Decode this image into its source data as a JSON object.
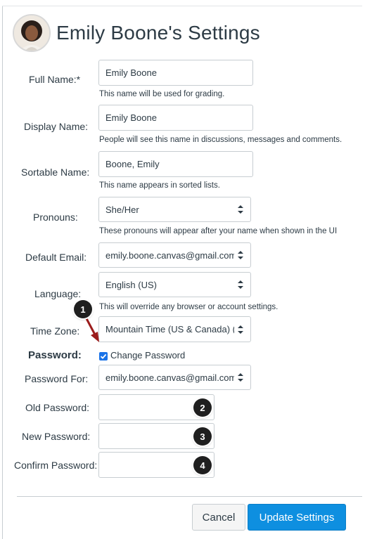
{
  "header": {
    "title": "Emily Boone's Settings"
  },
  "fields": {
    "full_name": {
      "label": "Full Name:*",
      "value": "Emily Boone",
      "hint": "This name will be used for grading."
    },
    "display_name": {
      "label": "Display Name:",
      "value": "Emily Boone",
      "hint": "People will see this name in discussions, messages and comments."
    },
    "sortable_name": {
      "label": "Sortable Name:",
      "value": "Boone, Emily",
      "hint": "This name appears in sorted lists."
    },
    "pronouns": {
      "label": "Pronouns:",
      "value": "She/Her",
      "hint": "These pronouns will appear after your name when shown in the UI"
    },
    "default_email": {
      "label": "Default Email:",
      "value": "emily.boone.canvas@gmail.com"
    },
    "language": {
      "label": "Language:",
      "value": "English (US)",
      "hint": "This will override any browser or account settings."
    },
    "time_zone": {
      "label": "Time Zone:",
      "value": "Mountain Time (US & Canada) (-"
    }
  },
  "password": {
    "heading": "Password:",
    "change_label": "Change Password",
    "change_checked": true,
    "for_label": "Password For:",
    "for_value": "emily.boone.canvas@gmail.com",
    "old_label": "Old Password:",
    "new_label": "New Password:",
    "confirm_label": "Confirm Password:"
  },
  "markers": [
    "1",
    "2",
    "3",
    "4"
  ],
  "buttons": {
    "cancel": "Cancel",
    "update": "Update Settings"
  },
  "colors": {
    "primary": "#0e8fe0",
    "checkbox": "#1a73e8",
    "arrow": "#9b1c1c",
    "marker": "#1f1f1f"
  }
}
